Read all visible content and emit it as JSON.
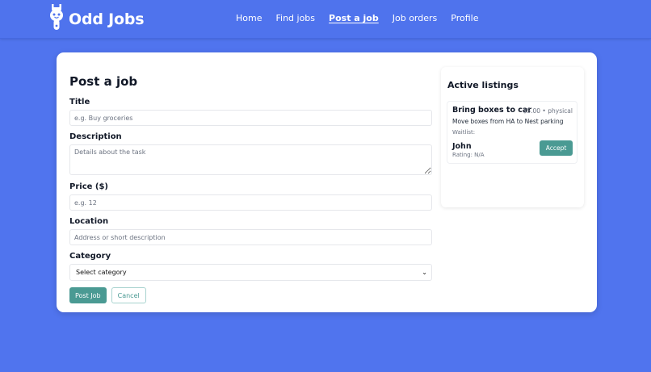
{
  "app": {
    "name": "Odd Jobs",
    "logo_icon": "wrench-face-icon"
  },
  "nav": {
    "items": [
      {
        "label": "Home",
        "active": false
      },
      {
        "label": "Find jobs",
        "active": false
      },
      {
        "label": "Post a job",
        "active": true
      },
      {
        "label": "Job orders",
        "active": false
      },
      {
        "label": "Profile",
        "active": false
      }
    ]
  },
  "form": {
    "title": "Post a job",
    "title_field": {
      "label": "Title",
      "placeholder": "e.g. Buy groceries",
      "value": ""
    },
    "description_field": {
      "label": "Description",
      "placeholder": "Details about the task",
      "value": ""
    },
    "price_field": {
      "label": "Price ($)",
      "placeholder": "e.g. 12",
      "value": ""
    },
    "location_field": {
      "label": "Location",
      "placeholder": "Address or short description",
      "value": ""
    },
    "category_field": {
      "label": "Category",
      "selected": "Select category"
    },
    "submit_label": "Post Job",
    "cancel_label": "Cancel"
  },
  "listings": {
    "title": "Active listings",
    "items": [
      {
        "title": "Bring boxes to car",
        "meta": "$5.00 • physical",
        "description": "Move boxes from HA to Nest parking",
        "waitlist_label": "Waitlist:",
        "applicants": [
          {
            "name": "John",
            "rating": "Rating: N/A",
            "action_label": "Accept"
          }
        ]
      }
    ]
  },
  "colors": {
    "background": "#5074ee",
    "accent": "#4a9a93",
    "card": "#ffffff"
  }
}
